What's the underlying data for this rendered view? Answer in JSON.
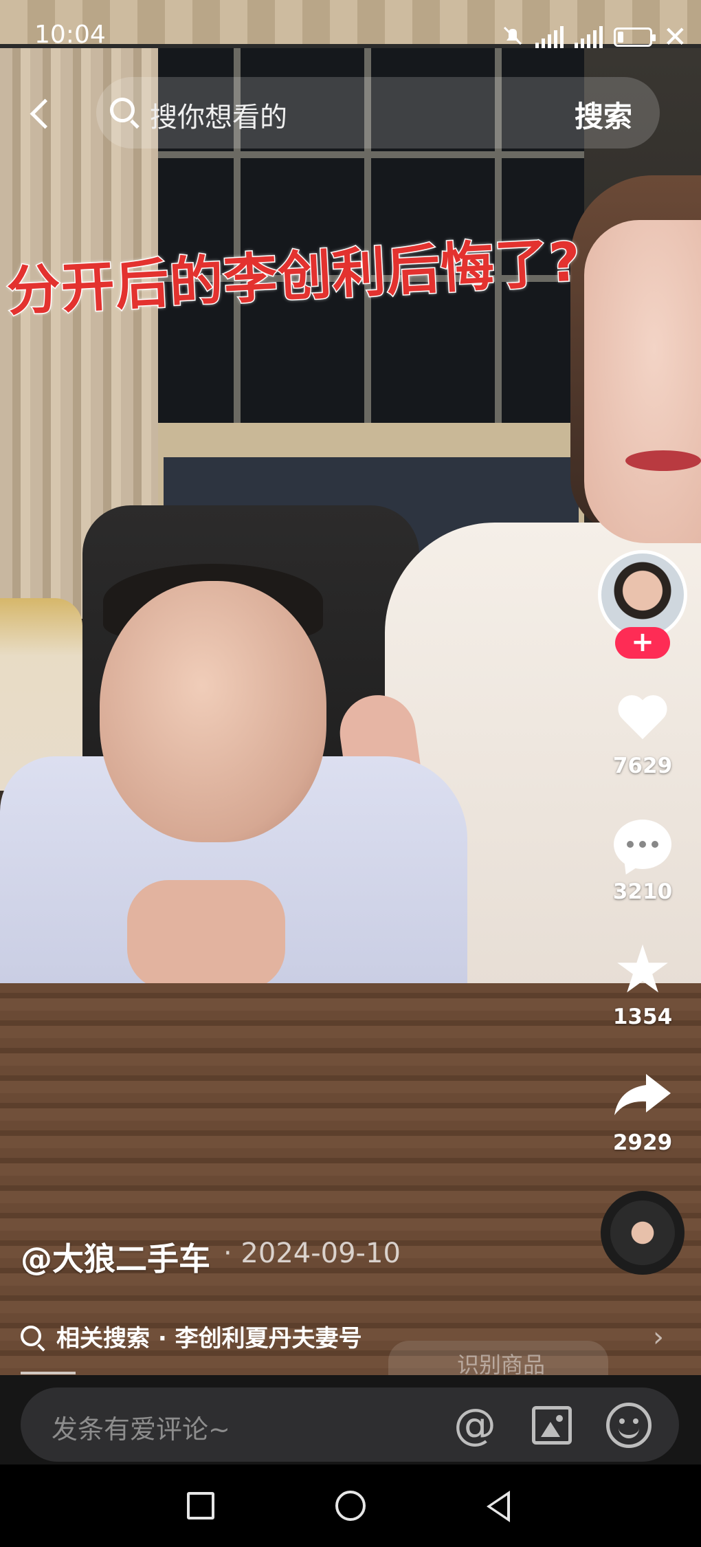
{
  "status_bar": {
    "time": "10:04",
    "icons": [
      "mute-bell-icon",
      "signal-icon",
      "signal-icon",
      "battery-icon",
      "close-icon"
    ]
  },
  "search": {
    "placeholder": "搜你想看的",
    "button_label": "搜索",
    "icons": [
      "back-icon",
      "search-icon"
    ]
  },
  "video": {
    "caption": "分开后的李创利后悔了?",
    "author": "@大狼二手车",
    "date": "· 2024-09-10",
    "related_search": "相关搜索 · 李创利夏丹夫妻号",
    "goods_chip": "识别商品"
  },
  "actions": {
    "follow_label": "+",
    "likes": "7629",
    "comments": "3210",
    "favorites": "1354",
    "shares": "2929"
  },
  "comment_bar": {
    "placeholder": "发条有爱评论~",
    "at_label": "@",
    "icons": [
      "at-icon",
      "image-icon",
      "emoji-icon"
    ]
  },
  "system_nav": {
    "icons": [
      "recents-icon",
      "home-icon",
      "back-icon"
    ]
  },
  "colors": {
    "accent": "#fe2c55",
    "caption_red": "#e3322f",
    "comment_bg": "#2e2e30"
  }
}
